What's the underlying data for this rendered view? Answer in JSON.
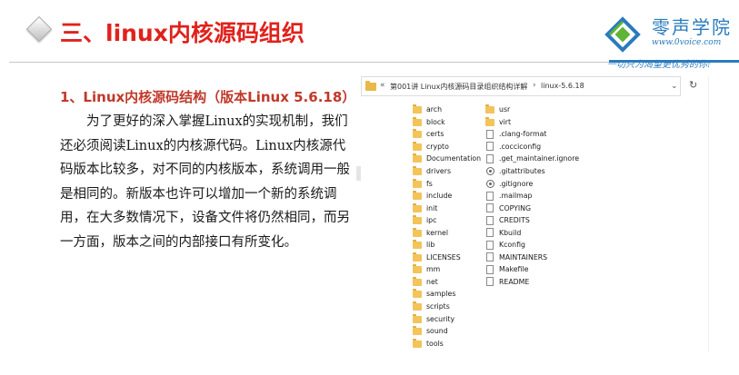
{
  "header": {
    "title": "三、linux内核源码组织",
    "logo_name": "零声学院",
    "logo_url": "www.0voice.com",
    "slogan": "一切只为渴望更优秀的你!"
  },
  "body": {
    "subheading": "1、Linux内核源码结构（版本Linux 5.6.18）",
    "paragraph": "为了更好的深入掌握Linux的实现机制，我们还必须阅读Linux的内核源代码。Linux内核源代码版本比较多，对不同的内核版本，系统调用一般是相同的。新版本也许可以增加一个新的系统调用，在大多数情况下，设备文件将仍然相同，而另一方面，版本之间的内部接口有所变化。"
  },
  "explorer": {
    "nav_arrows": "«",
    "breadcrumb_parent": "第001讲 Linux内核源码目录组织结构详解",
    "breadcrumb_sep": "›",
    "breadcrumb_current": "linux-5.6.18",
    "dropdown_glyph": "⌄",
    "refresh_glyph": "↻",
    "column1": [
      {
        "name": "arch",
        "icon": "folder-icon"
      },
      {
        "name": "block",
        "icon": "folder-icon"
      },
      {
        "name": "certs",
        "icon": "folder-icon"
      },
      {
        "name": "crypto",
        "icon": "folder-icon"
      },
      {
        "name": "Documentation",
        "icon": "folder-icon"
      },
      {
        "name": "drivers",
        "icon": "folder-icon"
      },
      {
        "name": "fs",
        "icon": "folder-icon"
      },
      {
        "name": "include",
        "icon": "folder-icon"
      },
      {
        "name": "init",
        "icon": "folder-icon"
      },
      {
        "name": "ipc",
        "icon": "folder-icon"
      },
      {
        "name": "kernel",
        "icon": "folder-icon"
      },
      {
        "name": "lib",
        "icon": "folder-icon"
      },
      {
        "name": "LICENSES",
        "icon": "folder-icon"
      },
      {
        "name": "mm",
        "icon": "folder-icon"
      },
      {
        "name": "net",
        "icon": "folder-icon"
      },
      {
        "name": "samples",
        "icon": "folder-icon"
      },
      {
        "name": "scripts",
        "icon": "folder-icon"
      },
      {
        "name": "security",
        "icon": "folder-icon"
      },
      {
        "name": "sound",
        "icon": "folder-icon"
      },
      {
        "name": "tools",
        "icon": "folder-icon"
      }
    ],
    "column2": [
      {
        "name": "usr",
        "icon": "folder-icon"
      },
      {
        "name": "virt",
        "icon": "folder-icon"
      },
      {
        "name": ".clang-format",
        "icon": "file-icon"
      },
      {
        "name": ".cocciconfig",
        "icon": "file-icon"
      },
      {
        "name": ".get_maintainer.ignore",
        "icon": "file-icon"
      },
      {
        "name": ".gitattributes",
        "icon": "gear-file-icon"
      },
      {
        "name": ".gitignore",
        "icon": "gear-file-icon"
      },
      {
        "name": ".mailmap",
        "icon": "file-icon"
      },
      {
        "name": "COPYING",
        "icon": "file-icon"
      },
      {
        "name": "CREDITS",
        "icon": "file-icon"
      },
      {
        "name": "Kbuild",
        "icon": "file-icon"
      },
      {
        "name": "Kconfig",
        "icon": "file-icon"
      },
      {
        "name": "MAINTAINERS",
        "icon": "file-icon"
      },
      {
        "name": "Makefile",
        "icon": "file-icon"
      },
      {
        "name": "README",
        "icon": "file-icon"
      }
    ]
  },
  "colors": {
    "title_red": "#e0221c",
    "subheading_red": "#c0392b",
    "brand_blue": "#2a7bbd",
    "folder_yellow": "#f2c45a"
  }
}
